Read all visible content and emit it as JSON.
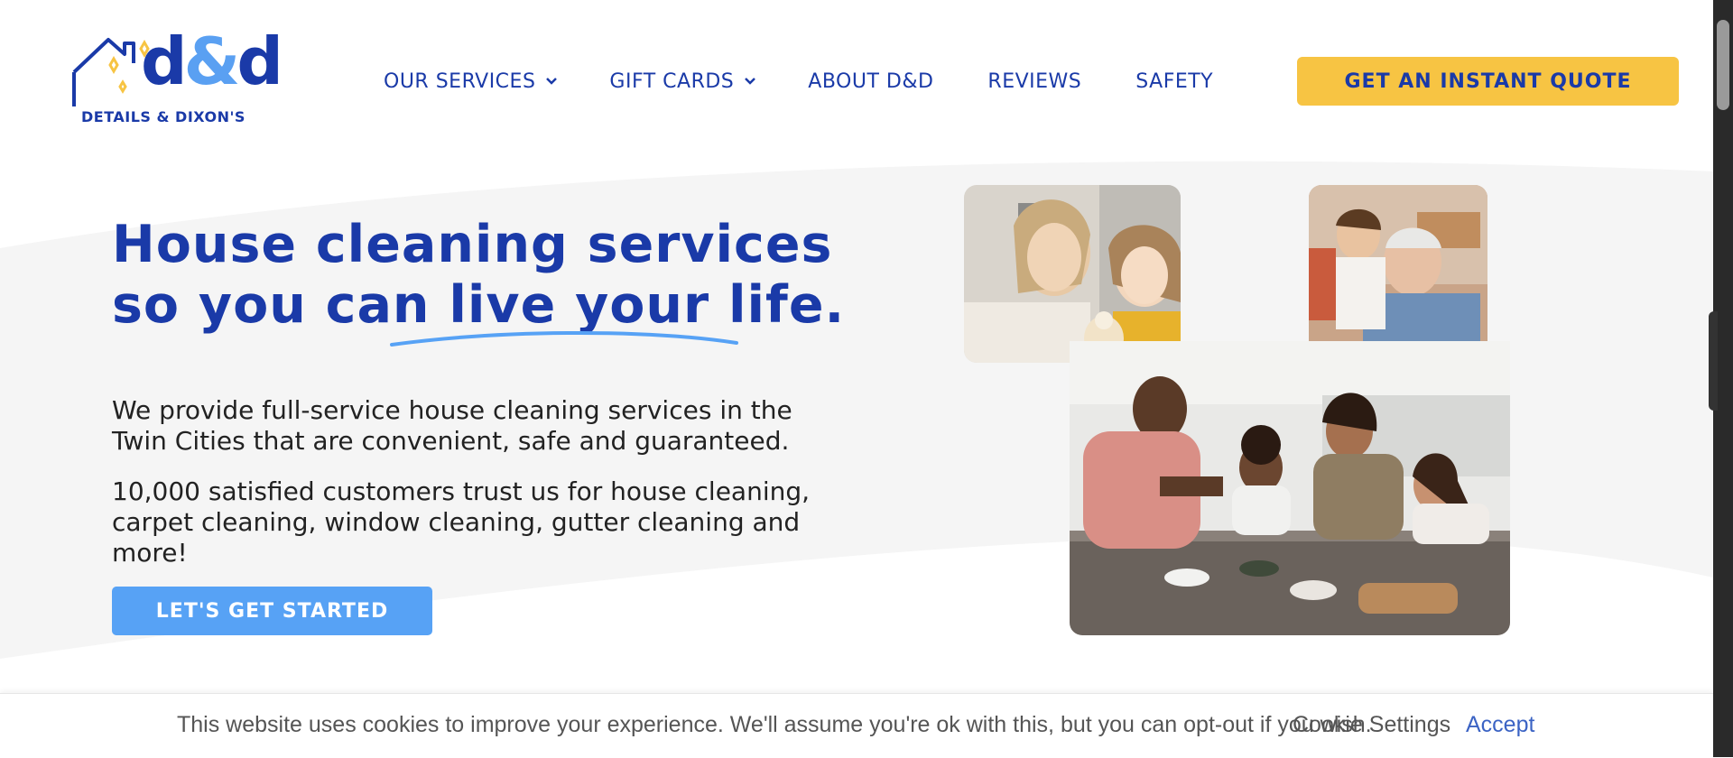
{
  "logo": {
    "brand_d1": "d",
    "brand_amp": "&",
    "brand_d2": "d",
    "tagline": "DETAILS & DIXON'S"
  },
  "nav": {
    "items": [
      {
        "label": "OUR SERVICES",
        "has_dropdown": true
      },
      {
        "label": "GIFT CARDS",
        "has_dropdown": true
      },
      {
        "label": "ABOUT D&D",
        "has_dropdown": false
      },
      {
        "label": "REVIEWS",
        "has_dropdown": false
      },
      {
        "label": "SAFETY",
        "has_dropdown": false
      }
    ],
    "cta": "GET AN INSTANT QUOTE"
  },
  "hero": {
    "title_line1": "House cleaning services",
    "title_line2_part1": "so you can ",
    "title_line2_highlight": "live your life",
    "title_line2_end": ".",
    "paragraph1": "We provide full-service house cleaning services in the Twin Cities that are convenient, safe and guaranteed.",
    "paragraph2": "10,000 satisfied customers trust us for house cleaning, carpet cleaning, window cleaning, gutter cleaning and more!",
    "button": "LET'S GET STARTED"
  },
  "photos": [
    {
      "name": "mother-daughter-photo"
    },
    {
      "name": "grandfather-grandson-photo"
    },
    {
      "name": "family-kitchen-photo"
    }
  ],
  "cookie_bar": {
    "message": "This website uses cookies to improve your experience. We'll assume you're ok with this, but you can opt-out if you wish.",
    "settings_label": "Cookie Settings",
    "accept_label": "Accept"
  },
  "colors": {
    "brand_blue": "#1a3aa8",
    "light_blue": "#57a2f5",
    "yellow": "#f7c443",
    "hero_bg": "#f5f5f5"
  }
}
